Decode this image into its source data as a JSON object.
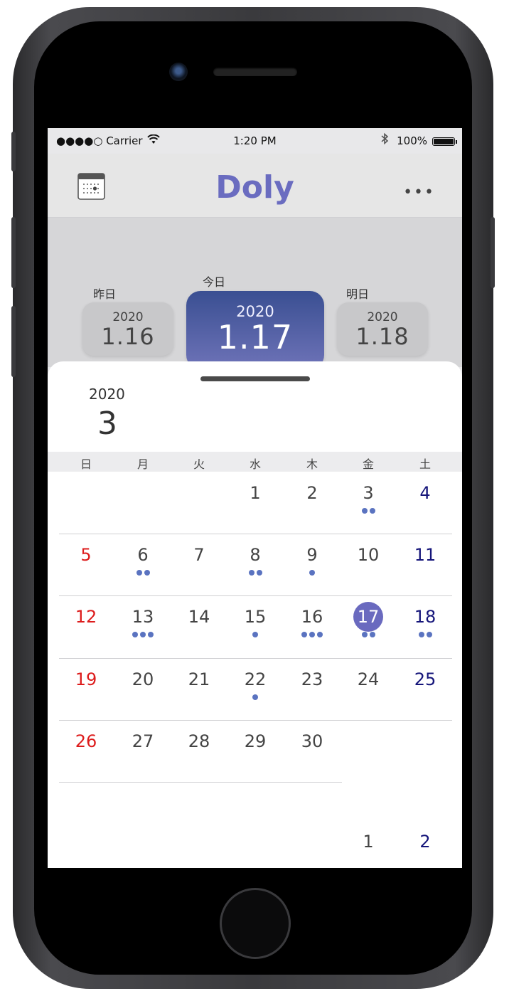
{
  "status_bar": {
    "carrier": "●●●●○ Carrier",
    "time": "1:20 PM",
    "battery": "100%",
    "bluetooth_icon": "bluetooth-icon"
  },
  "nav": {
    "title": "Doly",
    "calendar_icon": "calendar-icon",
    "more": "•••"
  },
  "days": {
    "prev": {
      "label": "昨日",
      "year": "2020",
      "date": "1.16"
    },
    "today": {
      "label": "今日",
      "year": "2020",
      "date": "1.17"
    },
    "next": {
      "label": "明日",
      "year": "2020",
      "date": "1.18"
    }
  },
  "calendar": {
    "year": "2020",
    "month": "3",
    "weekdays": [
      "日",
      "月",
      "火",
      "水",
      "木",
      "金",
      "土"
    ],
    "selected_day": "17",
    "weeks": [
      [
        null,
        null,
        null,
        {
          "d": "1",
          "dots": 0
        },
        {
          "d": "2",
          "dots": 0
        },
        {
          "d": "3",
          "dots": 2
        },
        {
          "d": "4",
          "dots": 0
        }
      ],
      [
        {
          "d": "5",
          "dots": 0
        },
        {
          "d": "6",
          "dots": 2
        },
        {
          "d": "7",
          "dots": 0
        },
        {
          "d": "8",
          "dots": 2
        },
        {
          "d": "9",
          "dots": 1
        },
        {
          "d": "10",
          "dots": 0
        },
        {
          "d": "11",
          "dots": 0
        }
      ],
      [
        {
          "d": "12",
          "dots": 0
        },
        {
          "d": "13",
          "dots": 3
        },
        {
          "d": "14",
          "dots": 0
        },
        {
          "d": "15",
          "dots": 1
        },
        {
          "d": "16",
          "dots": 3
        },
        {
          "d": "17",
          "dots": 2
        },
        {
          "d": "18",
          "dots": 2
        }
      ],
      [
        {
          "d": "19",
          "dots": 0
        },
        {
          "d": "20",
          "dots": 0
        },
        {
          "d": "21",
          "dots": 0
        },
        {
          "d": "22",
          "dots": 1
        },
        {
          "d": "23",
          "dots": 0
        },
        {
          "d": "24",
          "dots": 0
        },
        {
          "d": "25",
          "dots": 0
        }
      ],
      [
        {
          "d": "26",
          "dots": 0
        },
        {
          "d": "27",
          "dots": 0
        },
        {
          "d": "28",
          "dots": 0
        },
        {
          "d": "29",
          "dots": 0
        },
        {
          "d": "30",
          "dots": 0
        },
        null,
        null
      ]
    ],
    "next_month_preview": [
      null,
      null,
      null,
      null,
      null,
      {
        "d": "1",
        "dots": 0
      },
      {
        "d": "2",
        "dots": 0
      }
    ]
  },
  "colors": {
    "accent": "#6a6cc0",
    "today_gradient_top": "#3a4f92",
    "sunday": "#dd1c1c",
    "saturday": "#15157a",
    "dot": "#5a73c0"
  }
}
